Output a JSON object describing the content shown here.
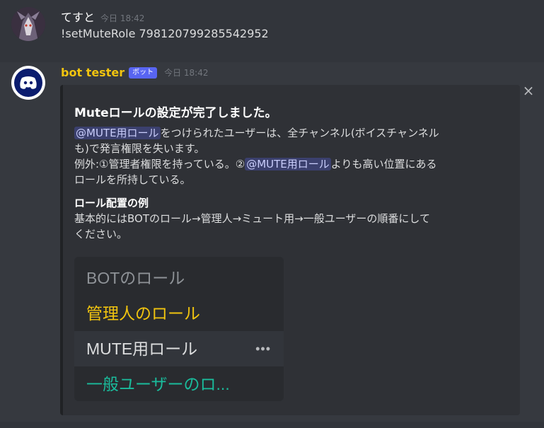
{
  "message1": {
    "author": "てすと",
    "timestamp": "今日 18:42",
    "text": "!setMuteRole 798120799285542952"
  },
  "message2": {
    "author": "bot tester",
    "badge": "ボット",
    "timestamp": "今日 18:42",
    "embed": {
      "close_icon": "×",
      "title": "Muteロールの設定が完了しました。",
      "description": {
        "mention1": "@MUTE用ロール",
        "text1": "をつけられたユーザーは、全チャンネル(ボイスチャンネル",
        "text2": "も)で発言権限を失います。",
        "text3": "例外:①管理者権限を持っている。②",
        "mention2": "@MUTE用ロール",
        "text4": "よりも高い位置にある",
        "text5": "ロールを所持している。"
      },
      "field": {
        "name": "ロール配置の例",
        "value_line1": "基本的にはBOTのロール→管理人→ミュート用→一般ユーザーの順番にして",
        "value_line2": "ください。"
      },
      "image": {
        "roles": [
          {
            "label": "BOTのロール",
            "color": "#8e9297"
          },
          {
            "label": "管理人のロール",
            "color": "#f1c40f"
          },
          {
            "label": "MUTE用ロール",
            "color": "#dcddde"
          },
          {
            "label": "一般ユーザーのロ...",
            "color": "#1abc9c"
          }
        ],
        "more_icon": "•••"
      }
    }
  },
  "colors": {
    "background": "#36393f",
    "embed_bg": "#2f3136",
    "bot_name": "#f1c40f",
    "badge": "#5865f2",
    "mention": "#c9cdfb"
  }
}
